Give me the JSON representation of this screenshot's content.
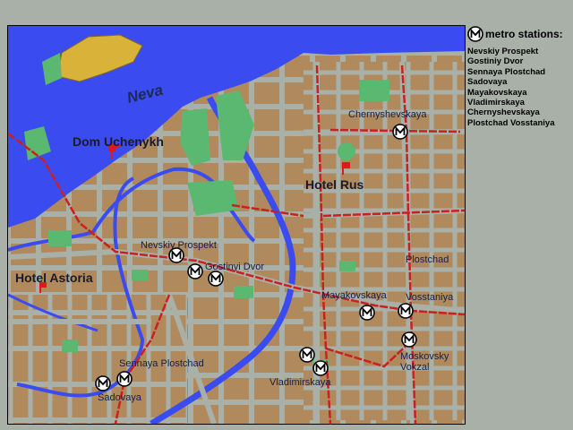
{
  "colors": {
    "background": "#a8b0a8",
    "city_block": "#b08a5c",
    "street": "#a8b0a8",
    "river": "#3a4cf0",
    "park": "#5ab870",
    "metro_line": "#cc1f1f",
    "landmark": "#d9b23a",
    "hotel_marker": "#e01818",
    "metro_icon_bg": "#ffffff",
    "metro_icon_fg": "#000000"
  },
  "legend": {
    "icon": "metro-m-icon",
    "title": "metro stations:",
    "stations": [
      "Nevskiy Prospekt",
      "Gostiniy Dvor",
      "Sennaya Plostchad",
      "Sadovaya",
      "Mayakovskaya",
      "Vladimirskaya",
      "Chernyshevskaya",
      "Plostchad Vosstaniya"
    ]
  },
  "map": {
    "river_label": "Neva",
    "hotels": [
      {
        "name": "Dom Uchenykh",
        "marker_icon": "hotel-flag-icon"
      },
      {
        "name": "Hotel Rus",
        "marker_icon": "hotel-flag-icon"
      },
      {
        "name": "Hotel Astoria",
        "marker_icon": "hotel-flag-icon"
      }
    ],
    "station_labels": {
      "chernyshevskaya": "Chernyshevskaya",
      "nevskiy": "Nevskiy Prospekt",
      "gostiniy": "Gostinyi Dvor",
      "mayakovskaya": "Mayakovskaya",
      "vosstaniya_1": "Plostchad",
      "vosstaniya_2": "Vosstaniya",
      "moskovsky_1": "Moskovsky",
      "moskovsky_2": "Vokzal",
      "sennaya": "Sennaya Plostchad",
      "sadovaya": "Sadovaya",
      "vladimirskaya": "Vladimirskaya"
    }
  }
}
